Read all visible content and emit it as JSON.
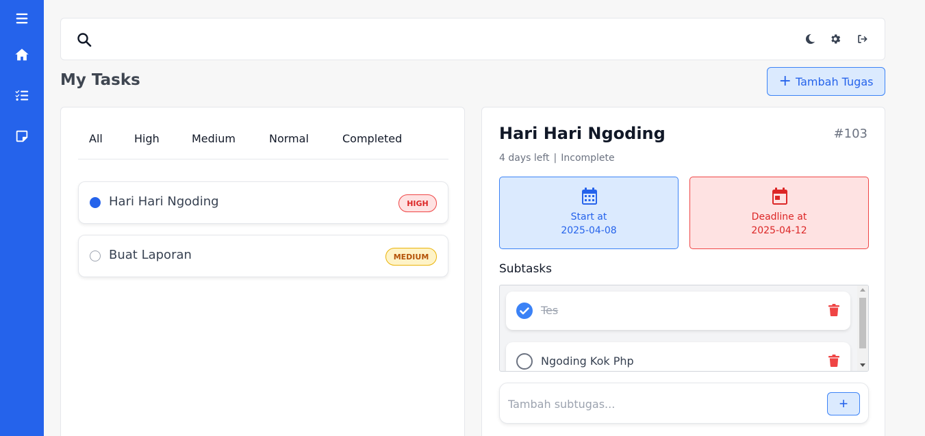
{
  "sidebar": {
    "items": [
      {
        "icon": "menu-icon"
      },
      {
        "icon": "home-icon"
      },
      {
        "icon": "task-list-icon"
      },
      {
        "icon": "note-icon"
      }
    ]
  },
  "topbar": {
    "search_placeholder": "",
    "icons": [
      "search-icon",
      "moon-icon",
      "gear-icon",
      "logout-icon"
    ]
  },
  "page": {
    "title": "My Tasks",
    "add_button_label": "Tambah Tugas"
  },
  "tabs": [
    "All",
    "High",
    "Medium",
    "Normal",
    "Completed"
  ],
  "tasks": [
    {
      "name": "Hari Hari Ngoding",
      "priority": "HIGH",
      "selected": true
    },
    {
      "name": "Buat Laporan",
      "priority": "MEDIUM",
      "selected": false
    }
  ],
  "detail": {
    "title": "Hari Hari Ngoding",
    "id": "#103",
    "days_left": "4 days left",
    "separator": "|",
    "status": "Incomplete",
    "start_label": "Start at",
    "start_date": "2025-04-08",
    "deadline_label": "Deadline at",
    "deadline_date": "2025-04-12",
    "subtasks_heading": "Subtasks",
    "subtasks": [
      {
        "label": "Tes",
        "done": true
      },
      {
        "label": "Ngoding Kok Php",
        "done": false
      }
    ],
    "add_subtask_placeholder": "Tambah subtugas...",
    "add_subtask_button": "+"
  },
  "colors": {
    "primary": "#2563eb",
    "high": "#dc2626",
    "medium": "#b45309"
  }
}
